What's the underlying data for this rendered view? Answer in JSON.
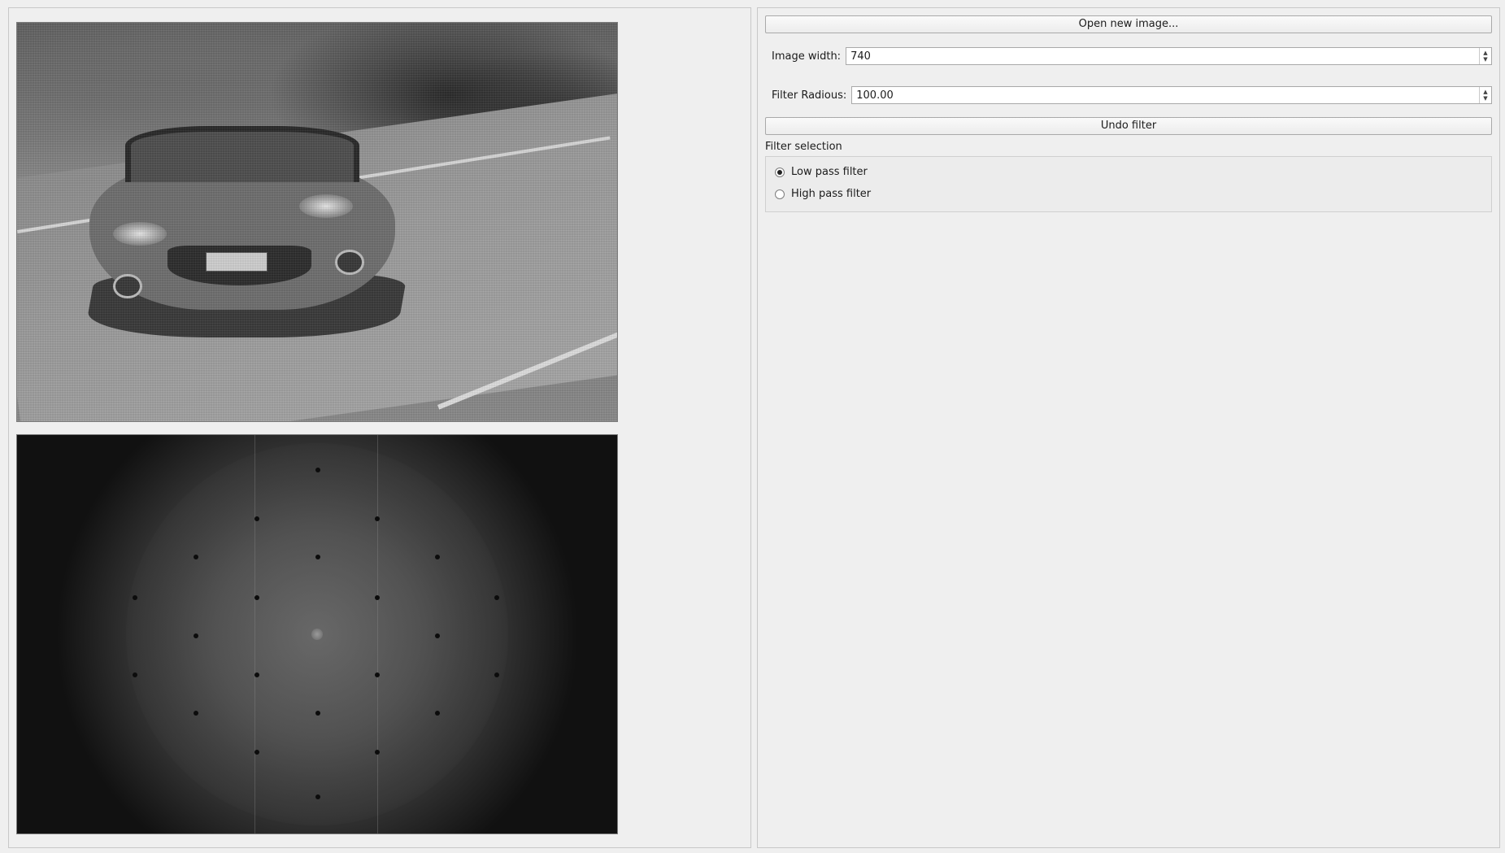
{
  "controls": {
    "open_button_label": "Open new image...",
    "image_width_label": "Image width:",
    "image_width_value": "740",
    "filter_radius_label": "Filter Radious:",
    "filter_radius_value": "100.00",
    "undo_button_label": "Undo filter",
    "filter_group_title": "Filter selection",
    "filters": [
      {
        "label": "Low pass filter",
        "checked": true
      },
      {
        "label": "High pass filter",
        "checked": false
      }
    ]
  },
  "icons": {
    "spin_up": "▲",
    "spin_down": "▼"
  }
}
